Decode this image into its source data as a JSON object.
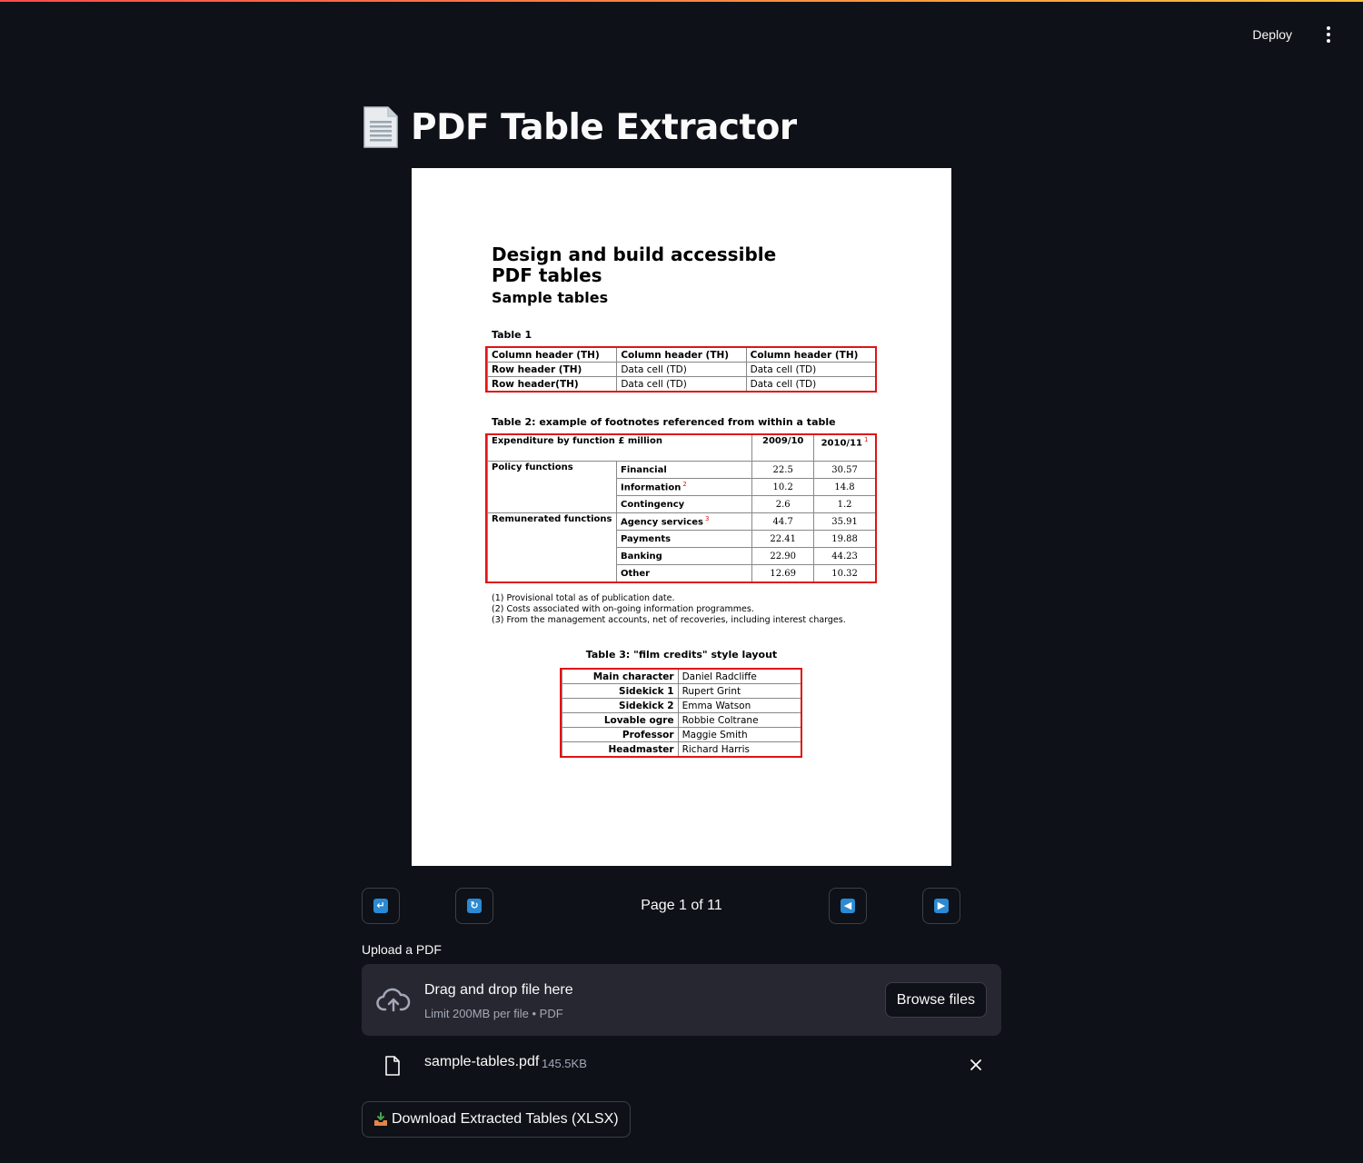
{
  "header": {
    "deploy_label": "Deploy",
    "menu_icon": "vertical-ellipsis-icon"
  },
  "page": {
    "title": "PDF Table Extractor",
    "title_icon": "page-facing-up-icon"
  },
  "pdf": {
    "heading": "Design and build accessible PDF tables",
    "subheading": "Sample tables",
    "table1": {
      "caption": "Table 1",
      "rows": [
        [
          "Column header (TH)",
          "Column header (TH)",
          "Column header (TH)"
        ],
        [
          "Row header (TH)",
          "Data cell (TD)",
          "Data cell (TD)"
        ],
        [
          "Row header(TH)",
          "Data cell (TD)",
          "Data cell (TD)"
        ]
      ]
    },
    "table2": {
      "caption": "Table 2: example of footnotes referenced from within a table",
      "header": [
        "Expenditure by function £ million",
        "2009/10",
        "2010/11"
      ],
      "header_footnote": "1",
      "groups": [
        {
          "label": "Policy functions",
          "rows": [
            {
              "label": "Financial",
              "fn": "",
              "v1": "22.5",
              "v2": "30.57"
            },
            {
              "label": "Information",
              "fn": "2",
              "v1": "10.2",
              "v2": "14.8"
            },
            {
              "label": "Contingency",
              "fn": "",
              "v1": "2.6",
              "v2": "1.2"
            }
          ]
        },
        {
          "label": "Remunerated functions",
          "rows": [
            {
              "label": "Agency services",
              "fn": "3",
              "v1": "44.7",
              "v2": "35.91"
            },
            {
              "label": "Payments",
              "fn": "",
              "v1": "22.41",
              "v2": "19.88"
            },
            {
              "label": "Banking",
              "fn": "",
              "v1": "22.90",
              "v2": "44.23"
            },
            {
              "label": "Other",
              "fn": "",
              "v1": "12.69",
              "v2": "10.32"
            }
          ]
        }
      ],
      "footnotes": [
        "(1) Provisional total as of publication date.",
        "(2) Costs associated with on-going information programmes.",
        "(3) From the management accounts, net of recoveries, including interest charges."
      ]
    },
    "table3": {
      "caption": "Table 3: \"film credits\" style layout",
      "rows": [
        [
          "Main character",
          "Daniel Radcliffe"
        ],
        [
          "Sidekick 1",
          "Rupert Grint"
        ],
        [
          "Sidekick 2",
          "Emma Watson"
        ],
        [
          "Lovable ogre",
          "Robbie Coltrane"
        ],
        [
          "Professor",
          "Maggie Smith"
        ],
        [
          "Headmaster",
          "Richard Harris"
        ]
      ]
    },
    "highlight_color": "#e01414"
  },
  "toolbar": {
    "rotate_left_icon": "rotate-left-icon",
    "rotate_right_icon": "rotate-right-icon",
    "prev_page_icon": "left-arrow-icon",
    "next_page_icon": "right-arrow-icon",
    "page_indicator": "Page 1 of 11"
  },
  "uploader": {
    "label": "Upload a PDF",
    "drop_text": "Drag and drop file here",
    "limit_text": "Limit 200MB per file • PDF",
    "browse_label": "Browse files",
    "file": {
      "name": "sample-tables.pdf",
      "size": "145.5KB"
    }
  },
  "download": {
    "label": "Download Extracted Tables (XLSX)",
    "icon": "inbox-tray-icon"
  },
  "colors": {
    "background": "#0e1117",
    "dropzone": "#262730",
    "accent_blue": "#2a8ad4"
  }
}
